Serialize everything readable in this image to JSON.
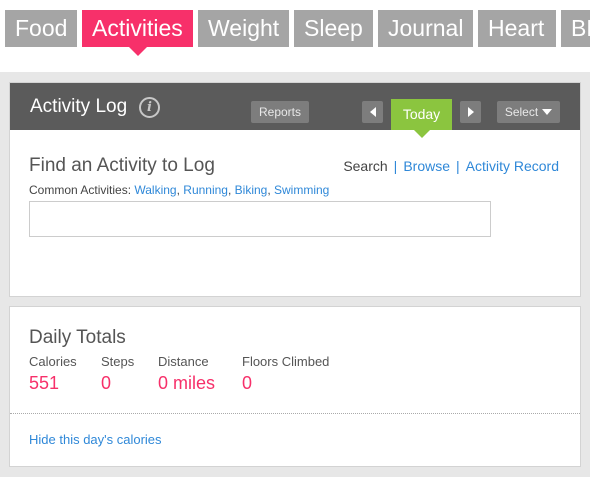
{
  "tabs": [
    {
      "label": "Food",
      "active": false
    },
    {
      "label": "Activities",
      "active": true
    },
    {
      "label": "Weight",
      "active": false
    },
    {
      "label": "Sleep",
      "active": false
    },
    {
      "label": "Journal",
      "active": false
    },
    {
      "label": "Heart",
      "active": false
    },
    {
      "label": "BP",
      "active": false
    }
  ],
  "activity_log": {
    "title": "Activity Log",
    "info_icon": "info-icon",
    "reports_label": "Reports",
    "today_label": "Today",
    "select_label": "Select",
    "find_title": "Find an Activity to Log",
    "search_label": "Search",
    "browse_label": "Browse",
    "record_label": "Activity Record",
    "separator": "|",
    "common_prefix": "Common Activities:",
    "common_activities": [
      "Walking",
      "Running",
      "Biking",
      "Swimming"
    ],
    "search_value": ""
  },
  "daily_totals": {
    "title": "Daily Totals",
    "metrics": [
      {
        "label": "Calories",
        "value": "551"
      },
      {
        "label": "Steps",
        "value": "0"
      },
      {
        "label": "Distance",
        "value": "0 miles"
      },
      {
        "label": "Floors Climbed",
        "value": "0"
      }
    ],
    "hide_link": "Hide this day's calories"
  },
  "colors": {
    "accent_pink": "#f7306a",
    "today_green": "#8bc53f",
    "tab_gray": "#a5a5a5",
    "header_dark": "#5b5b5b",
    "link_blue": "#2f88d8"
  }
}
